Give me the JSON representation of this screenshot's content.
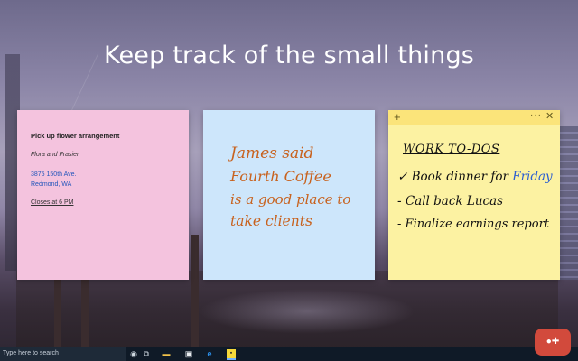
{
  "headline": "Keep track of the small things",
  "notes": {
    "pink": {
      "title": "Pick up flower arrangement",
      "subtitle": "Flora and Frasier",
      "address_line1": "3875 150th Ave.",
      "address_line2": "Redmond, WA",
      "closing": "Closes at 6 PM"
    },
    "blue": {
      "lines": [
        "James said",
        "Fourth Coffee",
        "is a good place to",
        "take clients"
      ]
    },
    "yellow": {
      "title": "WORK TO-DOS",
      "items": [
        {
          "bullet": "✓",
          "text": "Book dinner for",
          "highlight": "Friday"
        },
        {
          "bullet": "-",
          "text": "Call back Lucas"
        },
        {
          "bullet": "-",
          "text": "Finalize earnings report"
        }
      ],
      "header_icons": {
        "add": "plus-icon",
        "menu": "more-icon",
        "close": "close-icon"
      }
    }
  },
  "taskbar": {
    "search_placeholder": "Type here to search",
    "icons": [
      "mic-icon",
      "task-view-icon",
      "file-explorer-icon",
      "store-icon",
      "edge-icon",
      "sticky-notes-icon"
    ]
  },
  "colors": {
    "pink_note": "#f4c3de",
    "blue_note": "#cde6fb",
    "yellow_note": "#fcf2a2",
    "handwriting_orange": "#c8621e",
    "link_blue": "#2255bb"
  }
}
